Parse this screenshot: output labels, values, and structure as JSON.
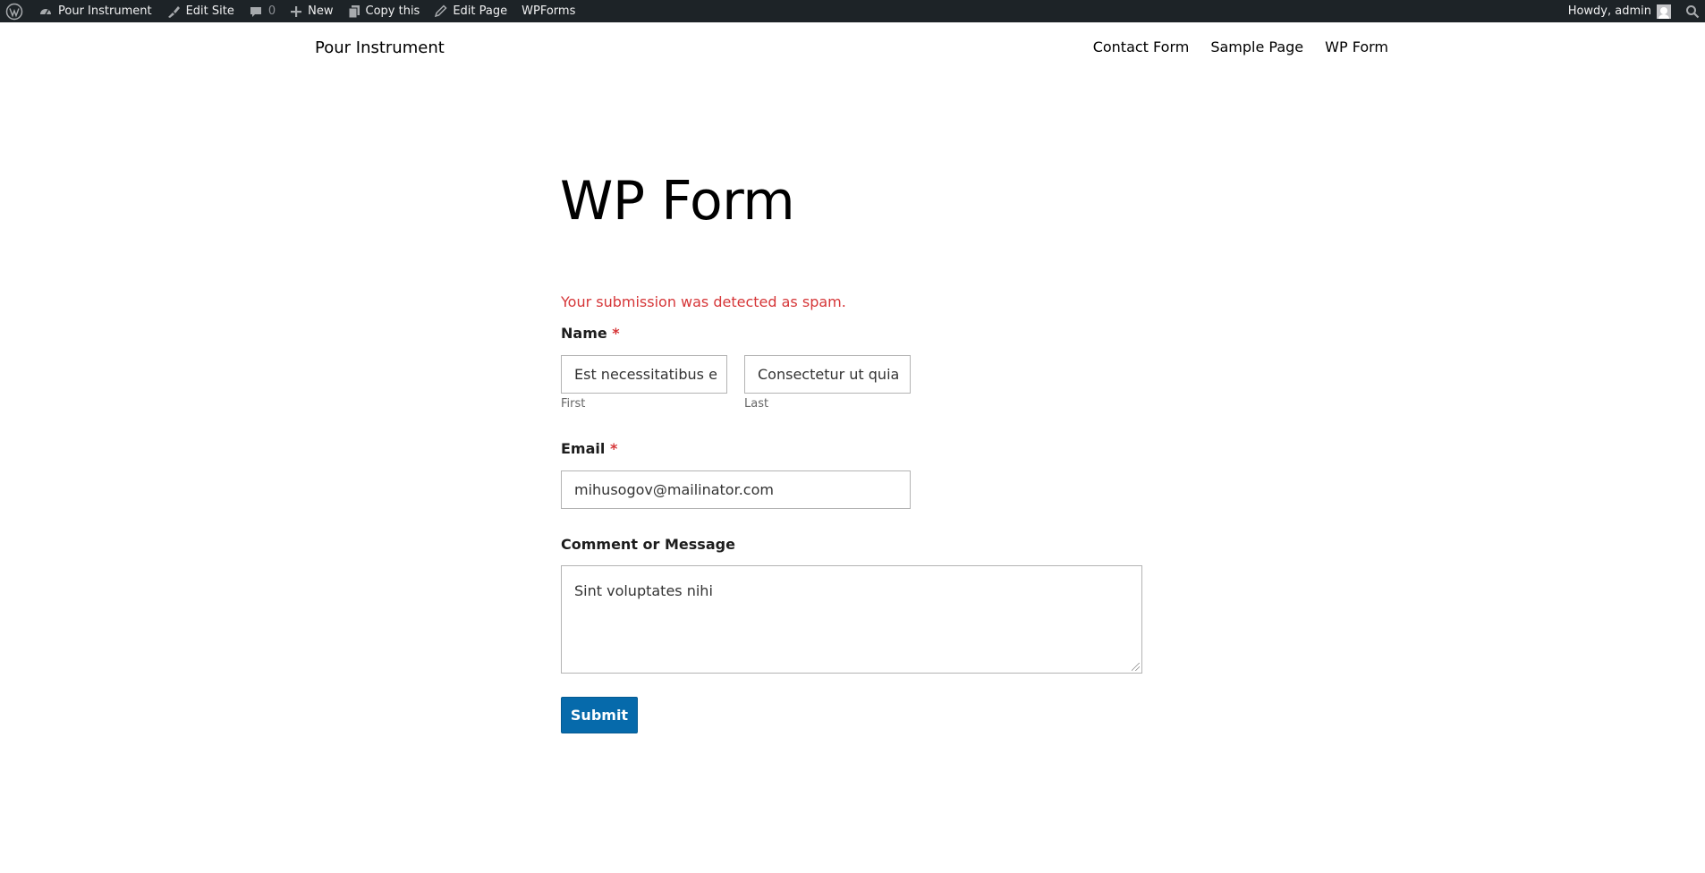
{
  "admin_bar": {
    "site_name": "Pour Instrument",
    "edit_site": "Edit Site",
    "comments_count": "0",
    "new": "New",
    "copy_this": "Copy this",
    "edit_page": "Edit Page",
    "wpforms": "WPForms",
    "howdy": "Howdy, admin"
  },
  "header": {
    "site_title": "Pour Instrument",
    "nav": [
      "Contact Form",
      "Sample Page",
      "WP Form"
    ]
  },
  "main": {
    "title": "WP Form",
    "error": "Your submission was detected as spam.",
    "name_label": "Name",
    "required_mark": "*",
    "first_value": "Est necessitatibus e",
    "first_sublabel": "First",
    "last_value": "Consectetur ut quia",
    "last_sublabel": "Last",
    "email_label": "Email",
    "email_value": "mihusogov@mailinator.com",
    "comment_label": "Comment or Message",
    "comment_value": "Sint voluptates nihi",
    "submit_label": "Submit"
  },
  "colors": {
    "admin_bar_bg": "#1d2327",
    "error_red": "#d63638",
    "button_blue": "#066aab"
  }
}
